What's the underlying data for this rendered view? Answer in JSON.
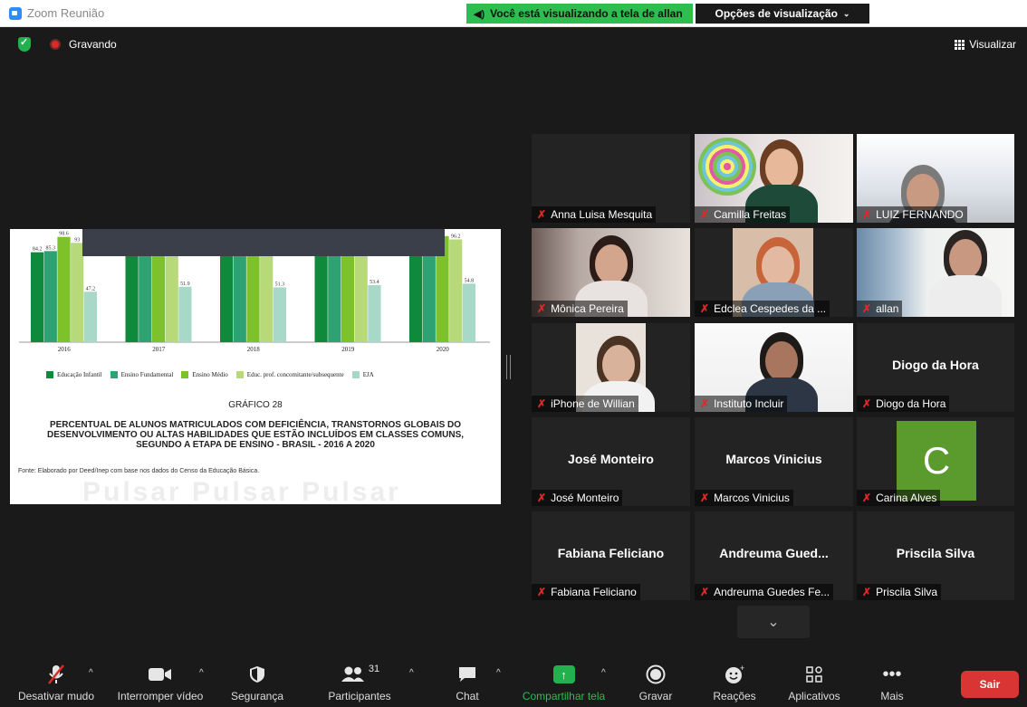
{
  "window": {
    "title": "Zoom Reunião"
  },
  "share_banner": {
    "text": "Você está visualizando a tela de allan",
    "options_label": "Opções de visualização"
  },
  "status": {
    "recording_label": "Gravando",
    "view_label": "Visualizar"
  },
  "shared_screen": {
    "chart_label": "GRÁFICO 28",
    "chart_title_lines": [
      "PERCENTUAL DE ALUNOS MATRICULADOS COM DEFICIÊNCIA, TRANSTORNOS GLOBAIS DO",
      "DESENVOLVIMENTO OU ALTAS HABILIDADES QUE ESTÃO INCLUÍDOS EM CLASSES COMUNS,",
      "SEGUNDO A ETAPA DE ENSINO - BRASIL - 2016 A 2020"
    ],
    "source": "Fonte: Elaborado por Deed/Inep com base nos dados do Censo da Educação Básica.",
    "watermark": "Pulsar Pulsar Pulsar"
  },
  "chart_data": {
    "type": "bar",
    "categories": [
      "2016",
      "2017",
      "2018",
      "2019",
      "2020"
    ],
    "series": [
      {
        "name": "Educação Infantil",
        "color": "#0f8a3c",
        "values": [
          84.2,
          88.8,
          88.9,
          89.3,
          90.2
        ]
      },
      {
        "name": "Ensino Fundamental",
        "color": "#2fa274",
        "values": [
          85.3,
          87.0,
          88.5,
          89.1,
          90.1
        ]
      },
      {
        "name": "Ensino Médio",
        "color": "#7dc22b",
        "values": [
          98.6,
          99.2,
          99.1,
          99.2,
          99.3
        ]
      },
      {
        "name": "Educ. prof. concomitante/subsequente",
        "color": "#b7d97a",
        "values": [
          93.0,
          93.5,
          93.4,
          93.5,
          96.2
        ]
      },
      {
        "name": "EJA",
        "color": "#a7d8c8",
        "values": [
          47.2,
          51.9,
          51.3,
          53.4,
          54.8
        ]
      }
    ],
    "value_labels_visible": [
      [
        "84.2",
        "85.3",
        "98.6",
        "93",
        "47.2"
      ],
      [
        "88.8",
        "87",
        "",
        "",
        "51.9"
      ],
      [
        "88.9",
        "88.5",
        "",
        "",
        "51.3"
      ],
      [
        "",
        "89.1",
        "",
        "",
        "53.4"
      ],
      [
        "",
        "",
        "",
        "96.2",
        "54.8"
      ]
    ],
    "ylim": [
      0,
      100
    ]
  },
  "participants": [
    {
      "display": "",
      "label": "Anna Luisa Mesquita",
      "video": false
    },
    {
      "display": "",
      "label": "Camilla Freitas",
      "video": true
    },
    {
      "display": "",
      "label": "LUIZ FERNANDO",
      "video": true
    },
    {
      "display": "",
      "label": "Mônica Pereira",
      "video": true
    },
    {
      "display": "",
      "label": "Edclea Cespedes da ...",
      "video": true
    },
    {
      "display": "",
      "label": "allan",
      "video": true
    },
    {
      "display": "",
      "label": "iPhone de Willian",
      "video": true
    },
    {
      "display": "",
      "label": "Instituto Incluir",
      "video": true
    },
    {
      "display": "Diogo da Hora",
      "label": "Diogo da Hora",
      "video": false
    },
    {
      "display": "José Monteiro",
      "label": "José Monteiro",
      "video": false
    },
    {
      "display": "Marcos Vinicius",
      "label": "Marcos Vinicius",
      "video": false
    },
    {
      "display": "C",
      "label": "Carina Alves",
      "video": false
    },
    {
      "display": "Fabiana Feliciano",
      "label": "Fabiana Feliciano",
      "video": false
    },
    {
      "display": "Andreuma  Gued...",
      "label": "Andreuma Guedes Fe...",
      "video": false
    },
    {
      "display": "Priscila Silva",
      "label": "Priscila Silva",
      "video": false
    }
  ],
  "toolbar": {
    "mute": "Desativar mudo",
    "video": "Interromper vídeo",
    "security": "Segurança",
    "participants": "Participantes",
    "participants_count": "31",
    "chat": "Chat",
    "share": "Compartilhar tela",
    "record": "Gravar",
    "reactions": "Reações",
    "apps": "Aplicativos",
    "more": "Mais",
    "leave": "Sair"
  },
  "colors": {
    "share_green": "#2ebd4f",
    "leave_red": "#d93535",
    "active_speaker": "#e9e85c",
    "avatar_green": "#5b9a2c"
  }
}
